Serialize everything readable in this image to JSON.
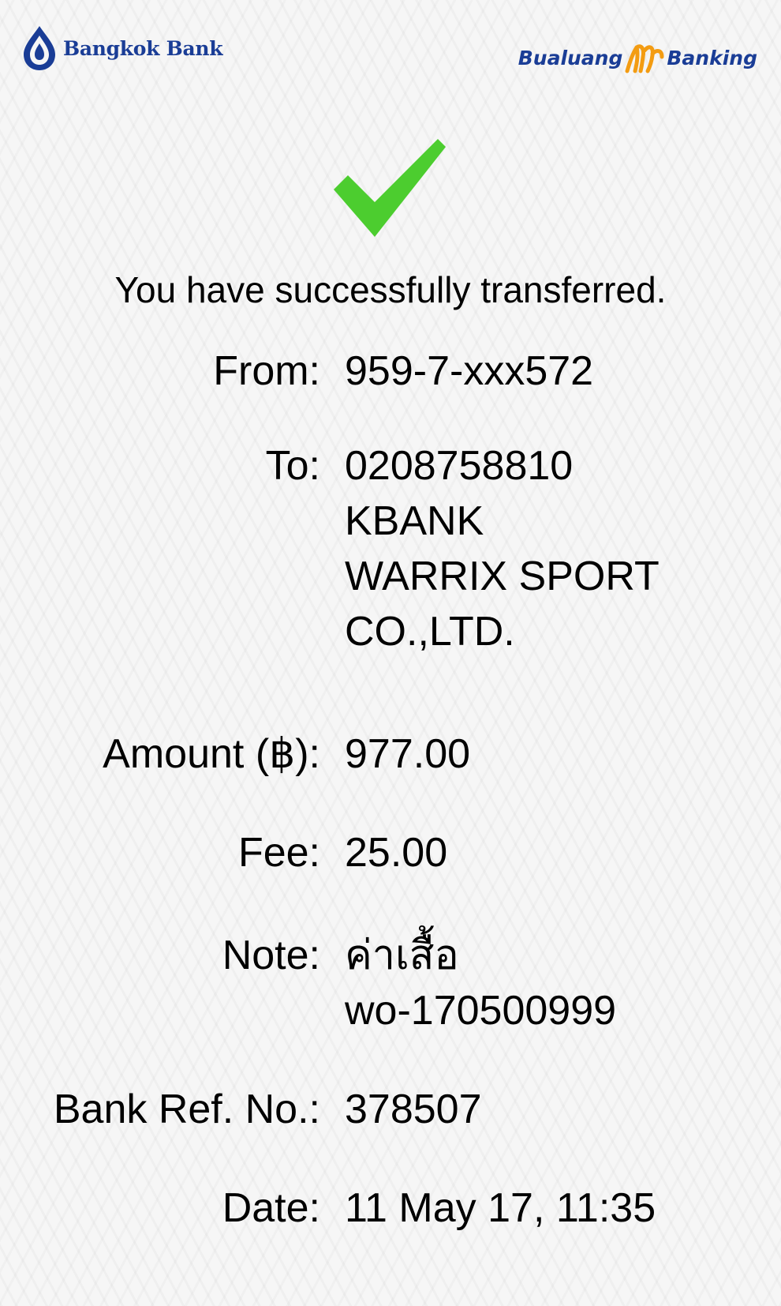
{
  "header": {
    "bank_name": "Bangkok Bank",
    "app_name_part1": "Bualuang",
    "app_name_part2": "Banking",
    "brand_color": "#1a3d96",
    "accent_color": "#f39c12"
  },
  "status": {
    "icon": "checkmark-icon",
    "icon_color": "#4ccd2f",
    "message": "You have successfully transferred."
  },
  "details": {
    "from_label": "From:",
    "from_value": "959-7-xxx572",
    "to_label": "To:",
    "to_lines": [
      "0208758810",
      "KBANK",
      "WARRIX SPORT",
      "CO.,LTD."
    ],
    "amount_label": "Amount (฿):",
    "amount_value": "977.00",
    "fee_label": "Fee:",
    "fee_value": "25.00",
    "note_label": "Note:",
    "note_lines": [
      "ค่าเสื้อ",
      "wo-170500999"
    ],
    "ref_label": "Bank Ref. No.:",
    "ref_value": "378507",
    "date_label": "Date:",
    "date_value": "11 May 17, 11:35"
  }
}
